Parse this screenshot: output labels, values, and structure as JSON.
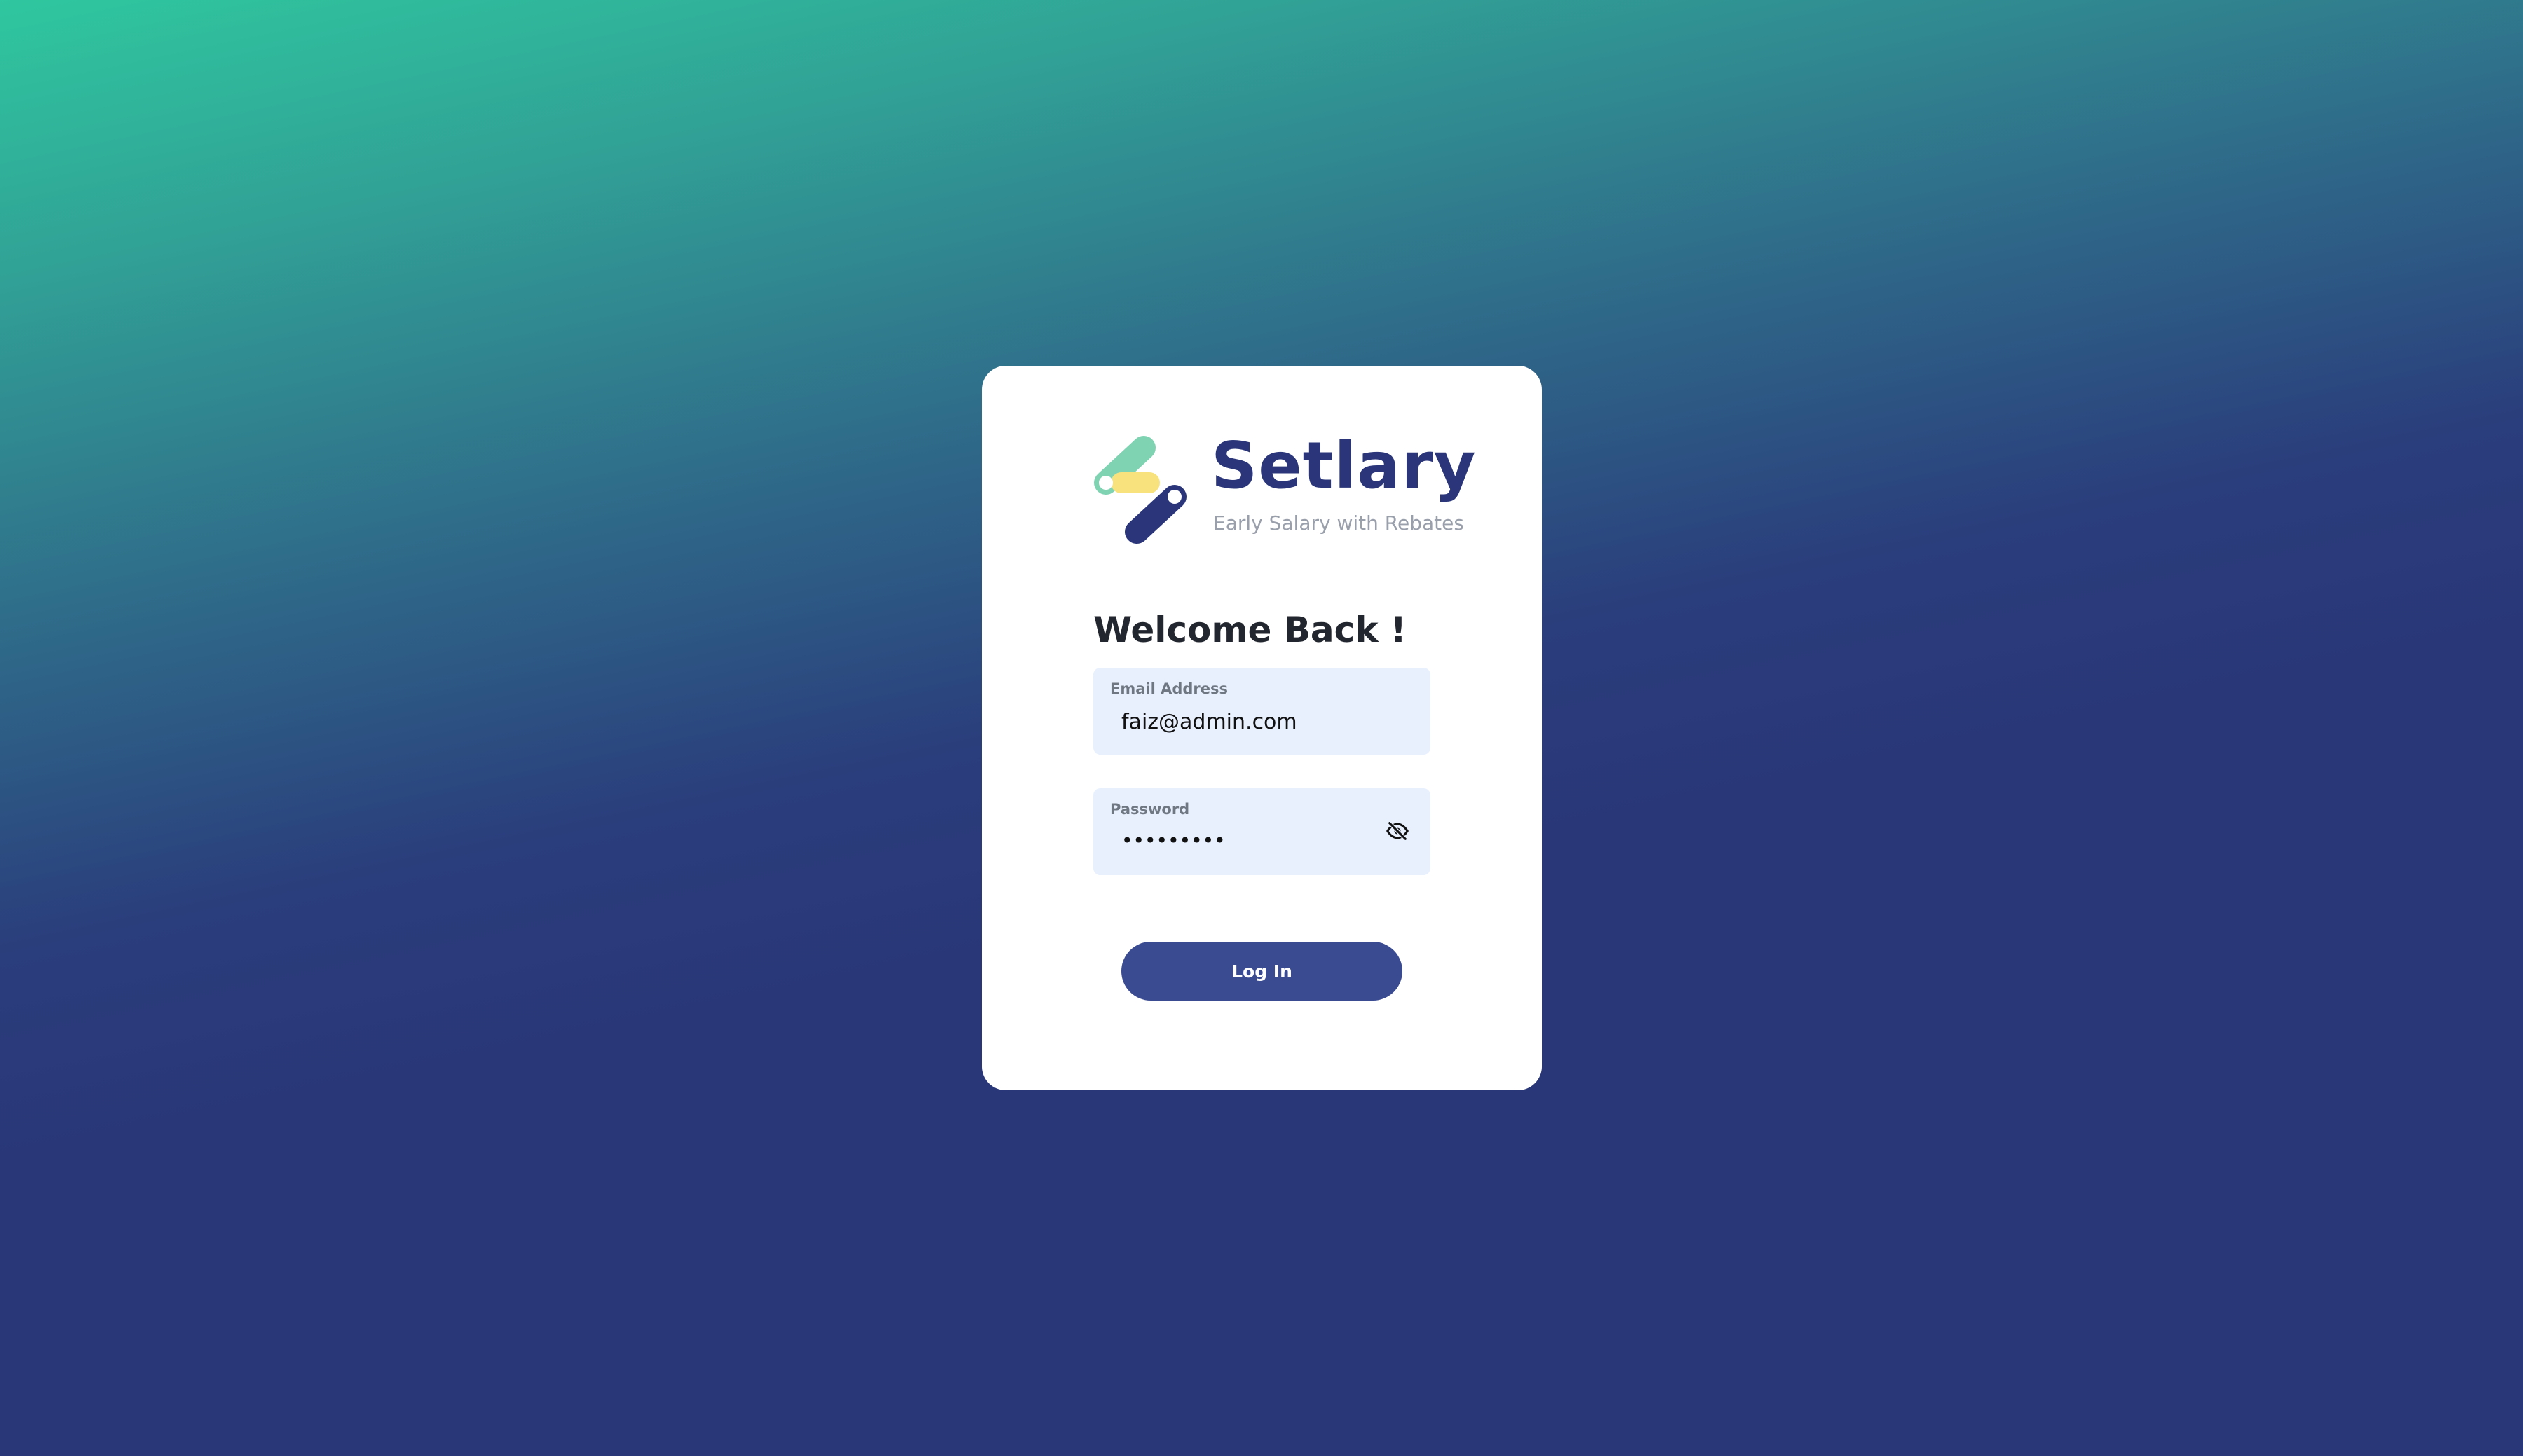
{
  "brand": {
    "name": "Setlary",
    "tagline": "Early Salary with Rebates",
    "colors": {
      "navy": "#2a3679",
      "mint": "#7fd3b2",
      "yellow": "#f7e27e"
    }
  },
  "login": {
    "heading": "Welcome Back !",
    "email": {
      "label": "Email Address",
      "value": "faiz@admin.com"
    },
    "password": {
      "label": "Password",
      "value": "•••••••••",
      "toggle_icon": "eye-off-icon"
    },
    "submit_label": "Log In"
  },
  "theme": {
    "gradient_top": "#2fc79f",
    "gradient_bottom": "#293677",
    "field_bg": "#e8f0fe",
    "button_bg": "#3b4b92"
  }
}
